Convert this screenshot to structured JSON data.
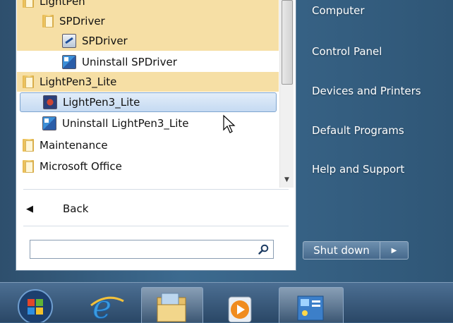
{
  "programs": [
    {
      "label": "LightPen",
      "icon": "folder-icon",
      "highlight": true
    },
    {
      "label": "SPDriver",
      "icon": "folder-icon",
      "highlight": true
    },
    {
      "label": "SPDriver",
      "icon": "spdriver-icon",
      "highlight": true
    },
    {
      "label": "Uninstall SPDriver",
      "icon": "uninstall-icon",
      "highlight": false
    },
    {
      "label": "LightPen3_Lite",
      "icon": "folder-icon",
      "highlight": true
    },
    {
      "label": "LightPen3_Lite",
      "icon": "lightpen-app-icon",
      "selected": true
    },
    {
      "label": "Uninstall LightPen3_Lite",
      "icon": "uninstall-icon",
      "highlight": false
    },
    {
      "label": "Maintenance",
      "icon": "folder-icon",
      "highlight": false
    },
    {
      "label": "Microsoft Office",
      "icon": "folder-icon",
      "highlight": false
    }
  ],
  "back": {
    "label": "Back",
    "icon": "back-arrow-icon"
  },
  "search": {
    "value": "",
    "placeholder": "",
    "icon": "search-icon"
  },
  "right_pane": {
    "items": [
      "Computer",
      "Control Panel",
      "Devices and Printers",
      "Default Programs",
      "Help and Support"
    ]
  },
  "shutdown": {
    "label": "Shut down",
    "arrow_icon": "chevron-right-icon"
  },
  "taskbar": {
    "items": [
      {
        "name": "start-orb-icon"
      },
      {
        "name": "internet-explorer-icon"
      },
      {
        "name": "windows-explorer-icon"
      },
      {
        "name": "media-player-icon"
      },
      {
        "name": "control-panel-icon"
      }
    ]
  },
  "colors": {
    "highlight": "#f6dfa5",
    "selected": "#c5daf2",
    "frame": "#3c6a8f"
  }
}
